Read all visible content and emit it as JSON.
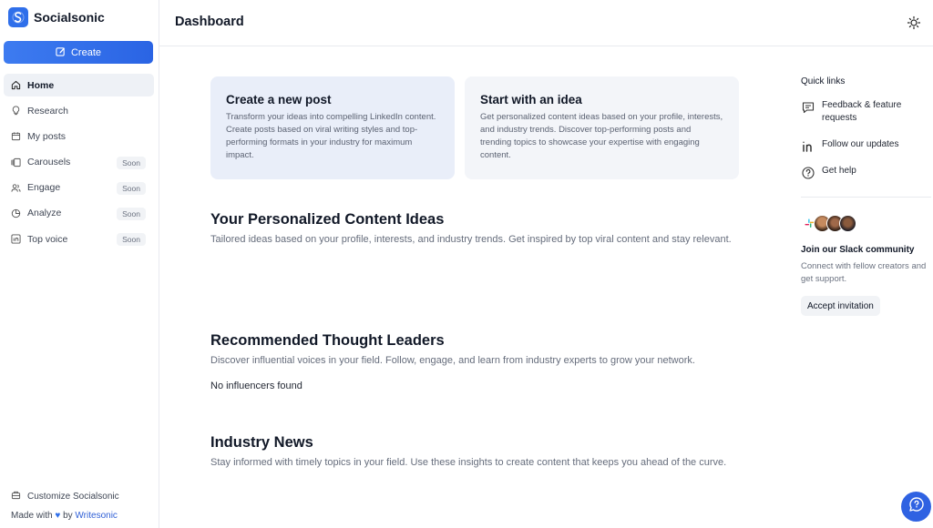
{
  "brand": {
    "name": "Socialsonic",
    "accent": "#2f6fea"
  },
  "sidebar": {
    "create_label": "Create",
    "items": [
      {
        "label": "Home",
        "icon": "home-icon",
        "active": true,
        "badge": ""
      },
      {
        "label": "Research",
        "icon": "lightbulb-icon",
        "badge": ""
      },
      {
        "label": "My posts",
        "icon": "calendar-icon",
        "badge": ""
      },
      {
        "label": "Carousels",
        "icon": "carousel-icon",
        "badge": "Soon"
      },
      {
        "label": "Engage",
        "icon": "users-icon",
        "badge": "Soon"
      },
      {
        "label": "Analyze",
        "icon": "pie-chart-icon",
        "badge": "Soon"
      },
      {
        "label": "Top voice",
        "icon": "linkedin-icon",
        "badge": "Soon"
      }
    ],
    "customize_label": "Customize Socialsonic",
    "made_with": {
      "prefix": "Made with",
      "by": "by",
      "link": "Writesonic"
    }
  },
  "header": {
    "title": "Dashboard"
  },
  "cards": [
    {
      "title": "Create a new post",
      "desc": "Transform your ideas into compelling LinkedIn content. Create posts based on viral writing styles and top-performing formats in your industry for maximum impact."
    },
    {
      "title": "Start with an idea",
      "desc": "Get personalized content ideas based on your profile, interests, and industry trends. Discover top-performing posts and trending topics to showcase your expertise with engaging content."
    }
  ],
  "sections": {
    "ideas": {
      "title": "Your Personalized Content Ideas",
      "desc": "Tailored ideas based on your profile, interests, and industry trends. Get inspired by top viral content and stay relevant."
    },
    "leaders": {
      "title": "Recommended Thought Leaders",
      "desc": "Discover influential voices in your field. Follow, engage, and learn from industry experts to grow your network.",
      "empty": "No influencers found"
    },
    "news": {
      "title": "Industry News",
      "desc": "Stay informed with timely topics in your field. Use these insights to create content that keeps you ahead of the curve."
    }
  },
  "quick_links": {
    "title": "Quick links",
    "items": [
      {
        "label": "Feedback & feature requests",
        "icon": "message-icon"
      },
      {
        "label": "Follow our updates",
        "icon": "linkedin-icon"
      },
      {
        "label": "Get help",
        "icon": "help-circle-icon"
      }
    ]
  },
  "slack": {
    "title": "Join our Slack community",
    "desc": "Connect with fellow creators and get support.",
    "button": "Accept invitation"
  }
}
